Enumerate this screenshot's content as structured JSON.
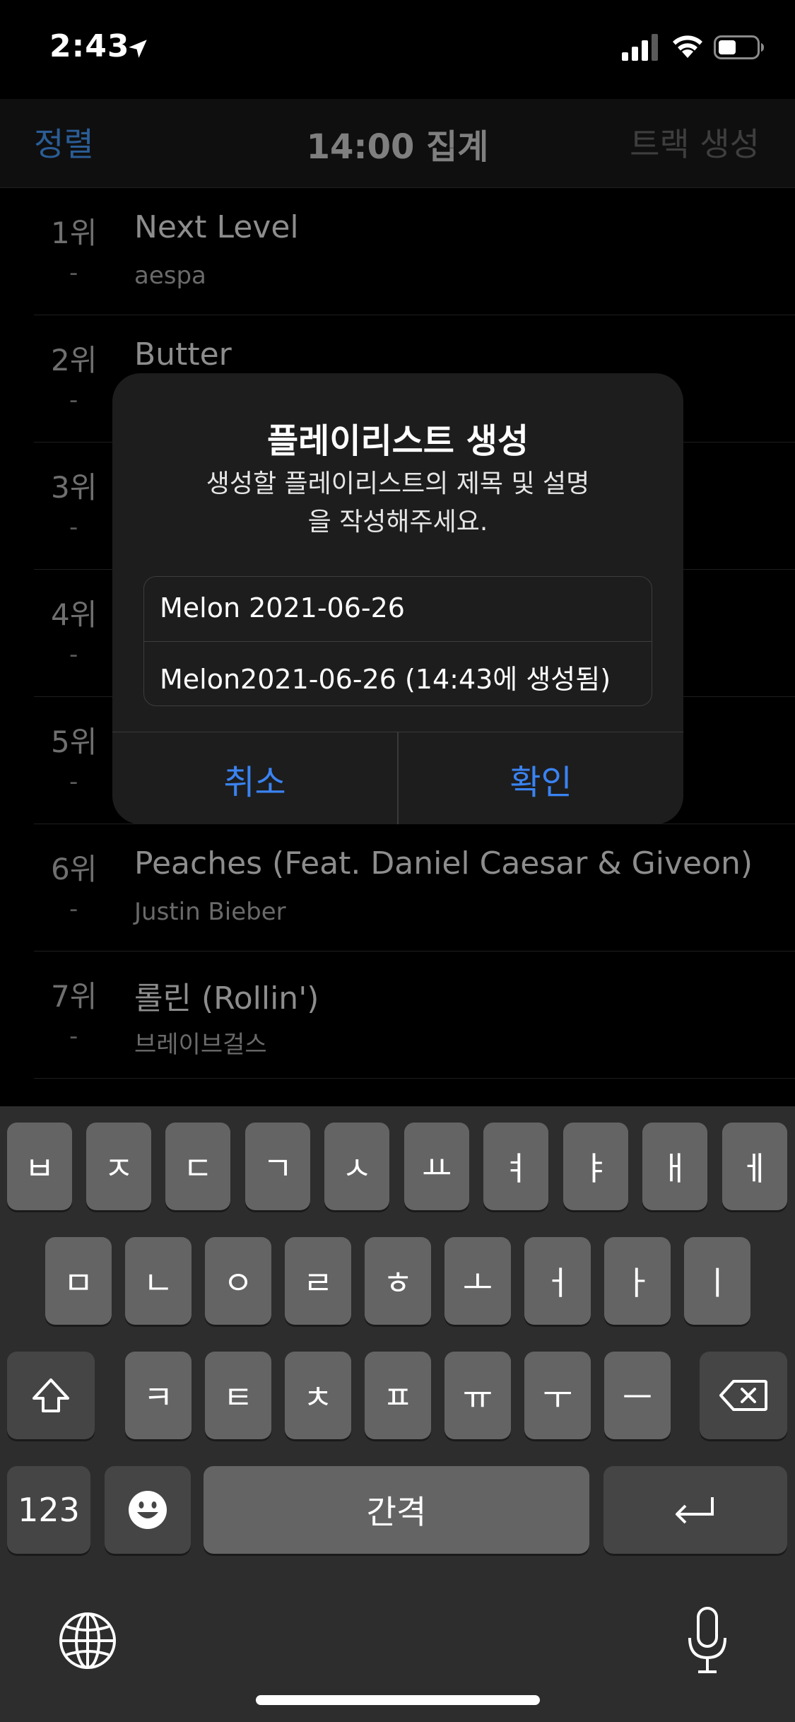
{
  "status": {
    "time": "2:43"
  },
  "nav": {
    "left": "정렬",
    "title": "14:00 집계",
    "right": "트랙 생성"
  },
  "chart": [
    {
      "rank": "1위",
      "change": "-",
      "title": "Next Level",
      "artist": "aespa"
    },
    {
      "rank": "2위",
      "change": "-",
      "title": "Butter",
      "artist": ""
    },
    {
      "rank": "3위",
      "change": "-",
      "title": "",
      "artist": ""
    },
    {
      "rank": "4위",
      "change": "-",
      "title": "",
      "artist": ""
    },
    {
      "rank": "5위",
      "change": "-",
      "title": "",
      "artist": ""
    },
    {
      "rank": "6위",
      "change": "-",
      "title": "Peaches (Feat. Daniel Caesar & Giveon)",
      "artist": "Justin Bieber"
    },
    {
      "rank": "7위",
      "change": "-",
      "title": "롤린 (Rollin')",
      "artist": "브레이브걸스"
    }
  ],
  "alert": {
    "title": "플레이리스트 생성",
    "message": "생성할 플레이리스트의 제목 및 설명을 작성해주세요.",
    "title_field": "Melon 2021-06-26",
    "description_field": "Melon2021-06-26 (14:43에 생성됨)",
    "cancel": "취소",
    "confirm": "확인"
  },
  "keyboard": {
    "row1": [
      "ㅂ",
      "ㅈ",
      "ㄷ",
      "ㄱ",
      "ㅅ",
      "ㅛ",
      "ㅕ",
      "ㅑ",
      "ㅐ",
      "ㅔ"
    ],
    "row2": [
      "ㅁ",
      "ㄴ",
      "ㅇ",
      "ㄹ",
      "ㅎ",
      "ㅗ",
      "ㅓ",
      "ㅏ",
      "ㅣ"
    ],
    "row3": [
      "ㅋ",
      "ㅌ",
      "ㅊ",
      "ㅍ",
      "ㅠ",
      "ㅜ",
      "ㅡ"
    ],
    "numbers": "123",
    "space": "간격"
  },
  "icons": {
    "location": "location-arrow-icon",
    "signal": "cellular-signal-icon",
    "wifi": "wifi-icon",
    "battery": "battery-icon",
    "shift": "shift-icon",
    "delete": "delete-icon",
    "emoji": "emoji-icon",
    "return": "return-icon",
    "globe": "globe-icon",
    "mic": "microphone-icon"
  },
  "colors": {
    "accent": "#3a83f2",
    "nav_left": "#2b5d96",
    "dialog_bg": "#1d1d1d",
    "keyboard_bg": "#2d2d2d",
    "key": "#646464",
    "key_dark": "#454545"
  }
}
